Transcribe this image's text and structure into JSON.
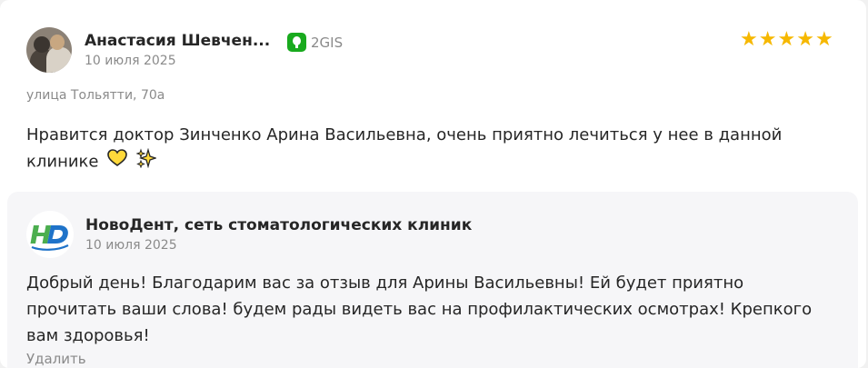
{
  "review": {
    "author": "Анастасия Шевчен...",
    "source": {
      "label": "2GIS",
      "icon": "2gis-icon",
      "color": "#19aa1e"
    },
    "date": "10 июля 2025",
    "rating": {
      "value": 5,
      "max": 5,
      "color": "#f6b800"
    },
    "address": "улица Тольятти, 70а",
    "text": "Нравится доктор Зинченко Арина Васильевна, очень приятно лечиться у нее в данной клинике",
    "emojis": [
      "yellow-heart-icon",
      "sparkles-icon"
    ]
  },
  "reply": {
    "company": "НовоДент, сеть стоматологических клиник",
    "logo_icon": "hd-logo-icon",
    "date": "10 июля 2025",
    "text": "Добрый день! Благодарим вас за отзыв для Арины Васильевны! Ей будет приятно прочитать ваши слова! будем рады видеть вас на профилактических осмотрах! Крепкого вам здоровья!",
    "delete_label": "Удалить"
  }
}
